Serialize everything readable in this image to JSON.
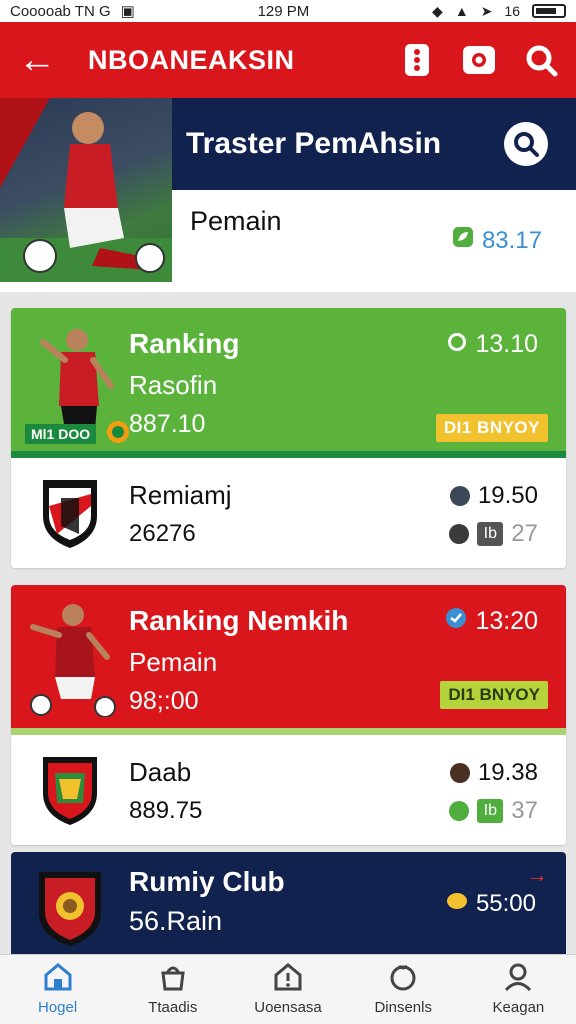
{
  "status_bar": {
    "left": "Cooooab TN G",
    "time": "129 PM",
    "right": "16"
  },
  "app_bar": {
    "title": "NBOANEAKSIN"
  },
  "hero": {
    "band_title": "Traster PemAhsin",
    "subtitle": "Pemain",
    "score": "83.17"
  },
  "cards": [
    {
      "top": {
        "title": "Ranking",
        "subtitle": "Rasofin",
        "value": "887.10",
        "time": "13.10",
        "badge": "DI1 BNYOY",
        "mini": "Ml1 DOO"
      },
      "bottom": {
        "title": "Remiamj",
        "value": "26276",
        "r1": "19.50",
        "r2_box": "Ib",
        "r2": "27"
      }
    },
    {
      "top": {
        "title": "Ranking Nemkih",
        "subtitle": "Pemain",
        "value": "98;:00",
        "time": "13:20",
        "badge": "DI1 BNYOY"
      },
      "bottom": {
        "title": "Daab",
        "value": "889.75",
        "r1": "19.38",
        "r2_box": "Ib",
        "r2": "37"
      }
    }
  ],
  "club_card": {
    "title": "Rumiy Club",
    "subtitle": "56.Rain",
    "value": "55:00"
  },
  "bottom_nav": [
    {
      "label": "Hogel",
      "icon": "home-icon",
      "active": true
    },
    {
      "label": "Ttaadis",
      "icon": "basket-icon",
      "active": false
    },
    {
      "label": "Uoensasa",
      "icon": "alert-house-icon",
      "active": false
    },
    {
      "label": "Dinsenls",
      "icon": "ball-icon",
      "active": false
    },
    {
      "label": "Keagan",
      "icon": "user-icon",
      "active": false
    }
  ],
  "colors": {
    "red": "#d9161c",
    "navy": "#12224f",
    "green": "#5cb33c",
    "accent_blue": "#2f7fd0"
  }
}
